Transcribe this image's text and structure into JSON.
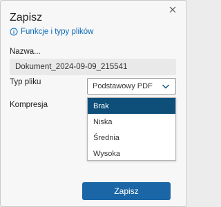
{
  "dialog": {
    "title": "Zapisz",
    "help_link": "Funkcje i typy plików",
    "help_icon": "info-icon",
    "close_icon": "close-icon"
  },
  "name": {
    "label": "Nazwa...",
    "value": "Dokument_2024-09-09_215541"
  },
  "file_type": {
    "label": "Typ pliku",
    "selected": "Podstawowy PDF"
  },
  "compression": {
    "label": "Kompresja",
    "options": [
      "Brak",
      "Niska",
      "Średnia",
      "Wysoka"
    ],
    "highlighted": "Brak"
  },
  "actions": {
    "save_label": "Zapisz"
  },
  "colors": {
    "accent": "#1b66a6",
    "link": "#0b6ab8",
    "highlight": "#0e4f7a"
  }
}
